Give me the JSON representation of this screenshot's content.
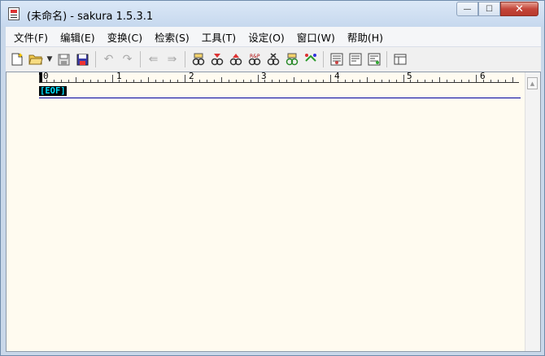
{
  "window": {
    "title": "(未命名) - sakura 1.5.3.1"
  },
  "caption": {
    "minimize": "—",
    "maximize": "☐",
    "close": "✕"
  },
  "menu": [
    {
      "label": "文件(F)"
    },
    {
      "label": "编辑(E)"
    },
    {
      "label": "变换(C)"
    },
    {
      "label": "检索(S)"
    },
    {
      "label": "工具(T)"
    },
    {
      "label": "设定(O)"
    },
    {
      "label": "窗口(W)"
    },
    {
      "label": "帮助(H)"
    }
  ],
  "ruler": {
    "numbers": [
      "0",
      "1",
      "2",
      "3",
      "4",
      "5",
      "6"
    ]
  },
  "editor": {
    "eof_marker": "[EOF]"
  },
  "toolbar_icons": [
    "new-file-icon",
    "open-folder-icon",
    "dropdown-caret-icon",
    "save-icon",
    "save-as-icon",
    "undo-icon",
    "redo-icon",
    "back-icon",
    "forward-icon",
    "find-icon",
    "find-next-icon",
    "find-prev-icon",
    "replace-icon",
    "grep-icon",
    "jump-icon",
    "outline-icon",
    "compare-icon",
    "tag-jump-icon",
    "tag-back-icon",
    "settings-icon",
    "window-list-icon"
  ]
}
